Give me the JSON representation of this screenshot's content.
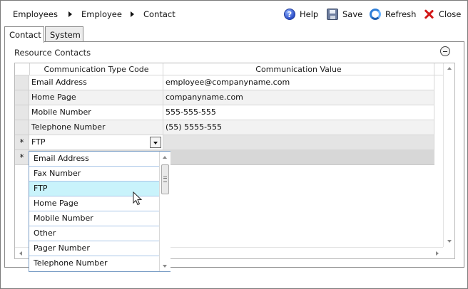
{
  "breadcrumb": [
    "Employees",
    "Employee",
    "Contact"
  ],
  "toolbar": {
    "help": "Help",
    "save": "Save",
    "refresh": "Refresh",
    "close": "Close"
  },
  "tabs": [
    {
      "label": "Contact",
      "active": true
    },
    {
      "label": "System",
      "active": false
    }
  ],
  "section": {
    "title": "Resource Contacts"
  },
  "grid": {
    "columns": [
      "Communication Type Code",
      "Communication Value"
    ],
    "rows": [
      {
        "type": "Email Address",
        "value": "employee@companyname.com"
      },
      {
        "type": "Home Page",
        "value": "companyname.com"
      },
      {
        "type": "Mobile Number",
        "value": "555-555-555"
      },
      {
        "type": "Telephone Number",
        "value": "(55) 5555-555"
      }
    ],
    "edit_row": {
      "marker": "*",
      "type": "FTP",
      "value": ""
    },
    "new_row": {
      "marker": "*"
    }
  },
  "dropdown": {
    "selected": "FTP",
    "options": [
      "Email Address",
      "Fax Number",
      "FTP",
      "Home Page",
      "Mobile Number",
      "Other",
      "Pager Number",
      "Telephone Number"
    ],
    "hovered_index": 2
  },
  "colors": {
    "hover_highlight": "#c9f3fb",
    "close_icon": "#d21818",
    "help_icon": "#2d4fc8",
    "refresh_icon": "#2f7fd8"
  }
}
